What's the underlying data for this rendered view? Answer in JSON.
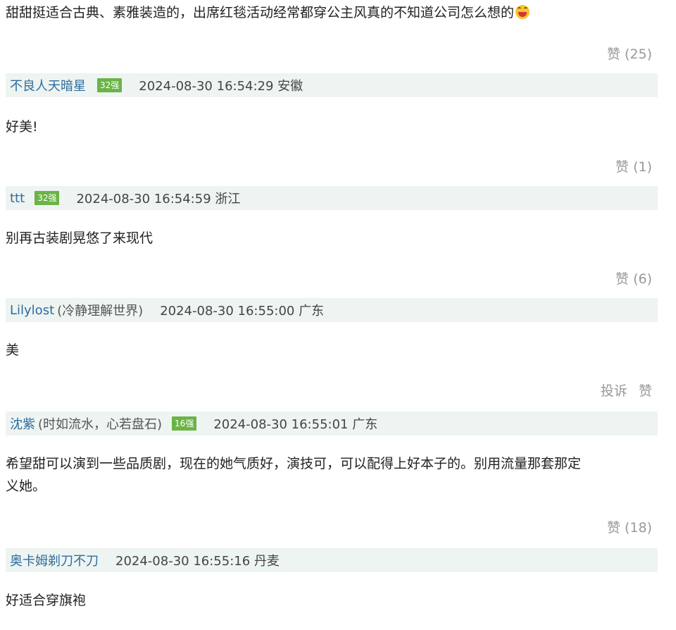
{
  "comments": [
    {
      "text": "甜甜挺适合古典、素雅装造的，出席红毯活动经常都穿公主风真的不知道公司怎么想的",
      "emoji": "laughing-face-emoji",
      "like_label": "赞 (25)"
    },
    {
      "user": "不良人天暗星",
      "badge": "32强",
      "time_loc": "2024-08-30 16:54:29 安徽",
      "text": "好美!",
      "like_label": "赞 (1)"
    },
    {
      "user": "ttt",
      "badge": "32强",
      "time_loc": "2024-08-30 16:54:59 浙江",
      "text": "别再古装剧晃悠了来现代",
      "like_label": "赞 (6)"
    },
    {
      "user": "Lilylost",
      "nickname": "(冷静理解世界)",
      "time_loc": "2024-08-30 16:55:00 广东",
      "text": "美",
      "report_label": "投诉",
      "like_label": "赞"
    },
    {
      "user": "沈紫",
      "nickname": "(时如流水，心若盘石)",
      "badge": "16强",
      "time_loc": "2024-08-30 16:55:01 广东",
      "text_line1": "希望甜可以演到一些品质剧，现在的她气质好，演技可，可以配得上好本子的。别用流量那套那定",
      "text_line2": "义她。",
      "like_label": "赞 (18)"
    },
    {
      "user": "奥卡姆剃刀不刀",
      "time_loc": "2024-08-30 16:55:16 丹麦",
      "text": "好适合穿旗袍"
    }
  ],
  "colors": {
    "username": "#2f6c9f",
    "meta_bg": "#eef4f1",
    "badge_bg": "#6ab446",
    "muted": "#999999"
  }
}
